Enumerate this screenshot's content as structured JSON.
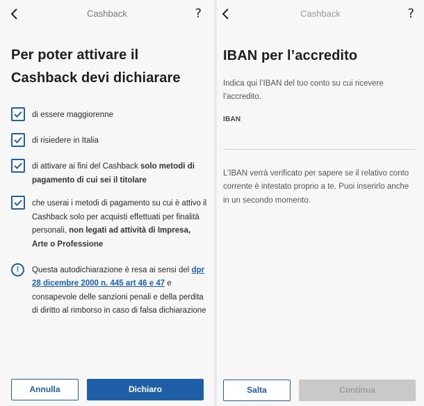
{
  "left_screen": {
    "title": "Cashback",
    "help": "?",
    "heading": "Per poter attivare il Cashback devi dichiarare",
    "checks": [
      {
        "text": "di essere maggiorenne"
      },
      {
        "text": "di risiedere in Italia"
      },
      {
        "text_a": "di attivare ai fini del Cashback ",
        "text_b": "solo metodi di pagamento di cui sei il titolare"
      },
      {
        "text_a": "che userai i metodi di pagamento su cui è attivo il Cashback solo per acquisti effettuati per finalità personali, ",
        "text_b": "non legati ad attività di Impresa, Arte o Professione"
      }
    ],
    "notice": {
      "before": "Questa autodichiarazione è resa ai sensi del ",
      "link": "dpr 28 dicembre 2000 n. 445 art 46 e 47",
      "after": " e consapevole delle sanzioni penali e della perdita di diritto al rimborso in caso di falsa dichiarazione"
    },
    "buttons": {
      "cancel": "Annulla",
      "confirm": "Dichiaro"
    }
  },
  "right_screen": {
    "title": "Cashback",
    "help": "?",
    "heading": "IBAN per l’accredito",
    "description": "Indica qui l’IBAN del tuo conto su cui ricevere l’accredito.",
    "iban_label": "IBAN",
    "iban_value": "",
    "note": "L’IBAN verrà verificato per sapere se il relativo conto corrente è intestato proprio a te. Puoi inserirlo anche in un secondo momento.",
    "buttons": {
      "skip": "Salta",
      "continue": "Continua"
    }
  },
  "colors": {
    "accent": "#1f5fa8",
    "disabled": "#c9c9c9"
  }
}
